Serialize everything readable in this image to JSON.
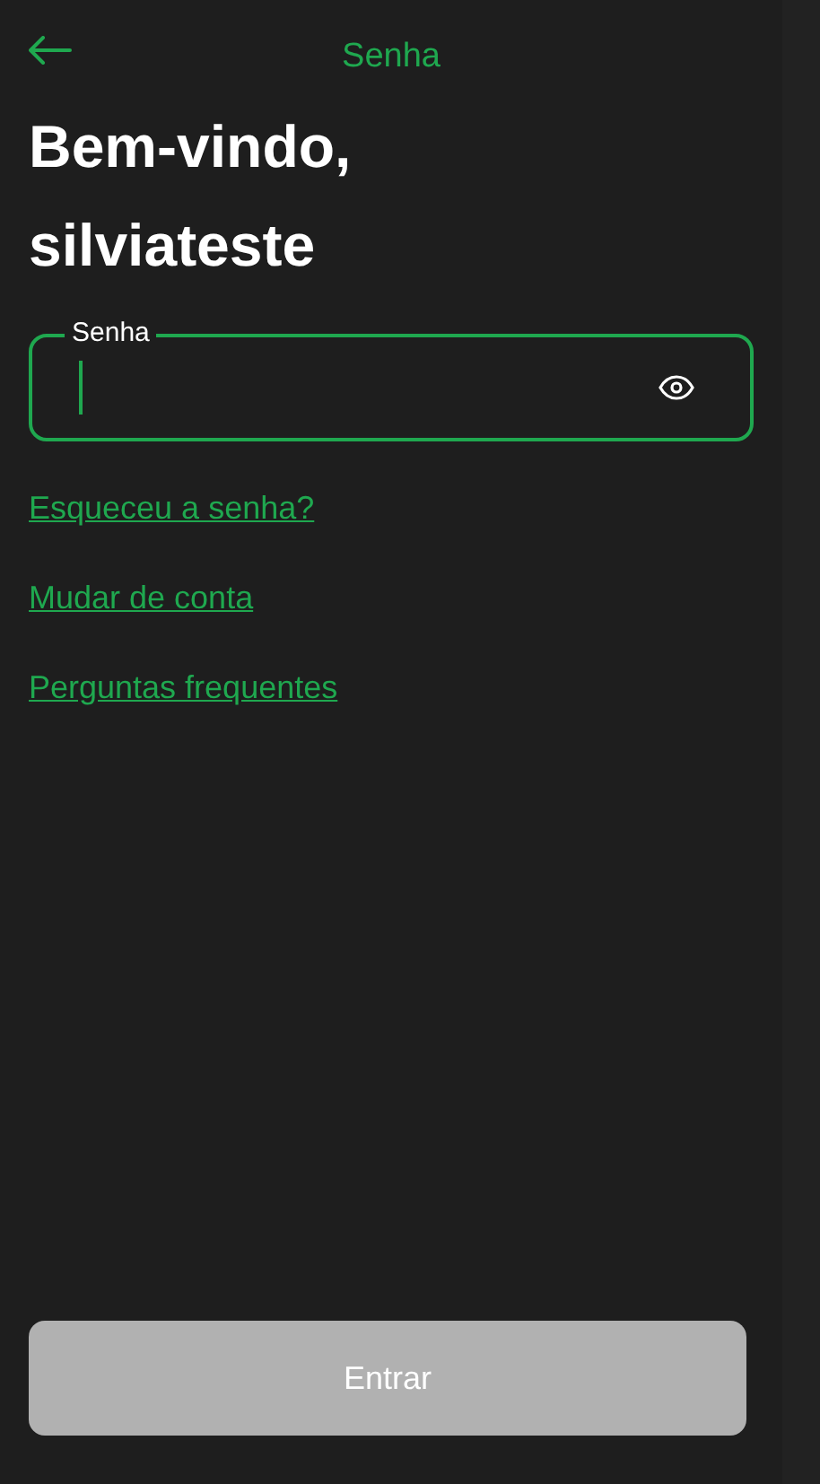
{
  "header": {
    "title": "Senha"
  },
  "greeting": "Bem-vindo, silviateste",
  "password_field": {
    "label": "Senha",
    "focused": true
  },
  "links": [
    {
      "label": "Esqueceu a senha?"
    },
    {
      "label": "Mudar de conta"
    },
    {
      "label": "Perguntas frequentes"
    }
  ],
  "submit_button": {
    "label": "Entrar",
    "disabled": true
  }
}
